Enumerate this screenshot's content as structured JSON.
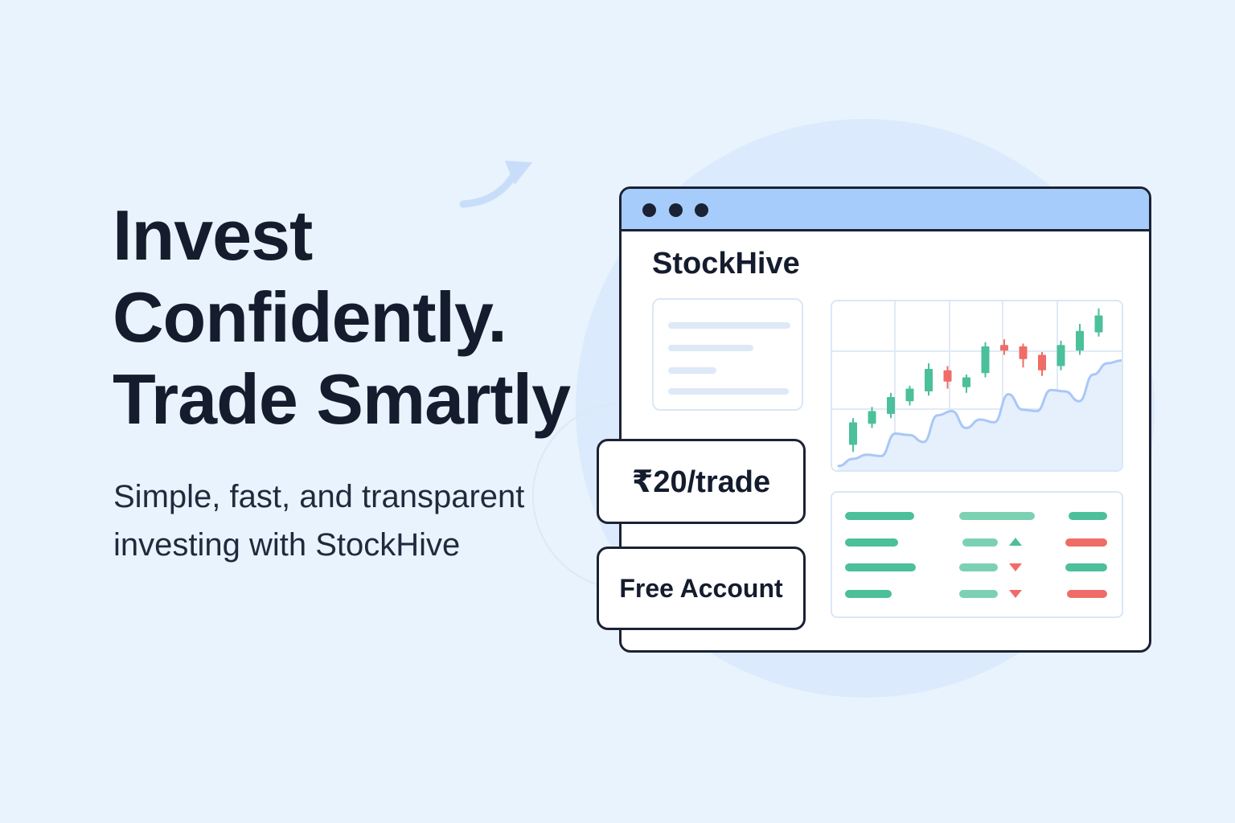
{
  "hero": {
    "headline": [
      "Invest",
      "Confidently.",
      "Trade Smartly"
    ],
    "subtitle": "Simple, fast, and transparent investing with StockHive"
  },
  "app_window": {
    "brand": "StockHive",
    "price_badge": "₹20/trade",
    "account_badge": "Free Account"
  },
  "colors": {
    "background": "#e9f3fd",
    "titlebar": "#a6ccfb",
    "up": "#4cbf9b",
    "down": "#ef6c67",
    "trend_line": "#a9c7f7"
  },
  "icons": {
    "deco_arrow": "curved-arrow-icon",
    "window_controls": "dot-icon",
    "up_indicator": "triangle-up-icon",
    "down_indicator": "triangle-down-icon"
  },
  "chart_data": {
    "type": "line",
    "title": "",
    "xlabel": "",
    "ylabel": "",
    "grid": true,
    "legend": "none",
    "series": [
      {
        "type": "candlestick",
        "up_color": "#4cbf9b",
        "down_color": "#ef6c67",
        "values": [
          {
            "open": 18,
            "close": 34,
            "high": 37,
            "low": 13
          },
          {
            "open": 33,
            "close": 42,
            "high": 45,
            "low": 30
          },
          {
            "open": 40,
            "close": 52,
            "high": 55,
            "low": 37
          },
          {
            "open": 49,
            "close": 58,
            "high": 60,
            "low": 46
          },
          {
            "open": 56,
            "close": 72,
            "high": 76,
            "low": 53
          },
          {
            "open": 71,
            "close": 63,
            "high": 74,
            "low": 58
          },
          {
            "open": 59,
            "close": 66,
            "high": 68,
            "low": 55
          },
          {
            "open": 69,
            "close": 88,
            "high": 91,
            "low": 66
          },
          {
            "open": 89,
            "close": 85,
            "high": 93,
            "low": 82
          },
          {
            "open": 88,
            "close": 79,
            "high": 90,
            "low": 73
          },
          {
            "open": 82,
            "close": 71,
            "high": 84,
            "low": 67
          },
          {
            "open": 74,
            "close": 89,
            "high": 92,
            "low": 71
          },
          {
            "open": 85,
            "close": 99,
            "high": 104,
            "low": 82
          },
          {
            "open": 98,
            "close": 110,
            "high": 115,
            "low": 95
          }
        ]
      },
      {
        "type": "area",
        "color": "#a9c7f7",
        "values": [
          3,
          8,
          11,
          10,
          26,
          25,
          20,
          39,
          42,
          30,
          36,
          34,
          54,
          43,
          42,
          57,
          56,
          49,
          68,
          76,
          78
        ]
      }
    ]
  }
}
